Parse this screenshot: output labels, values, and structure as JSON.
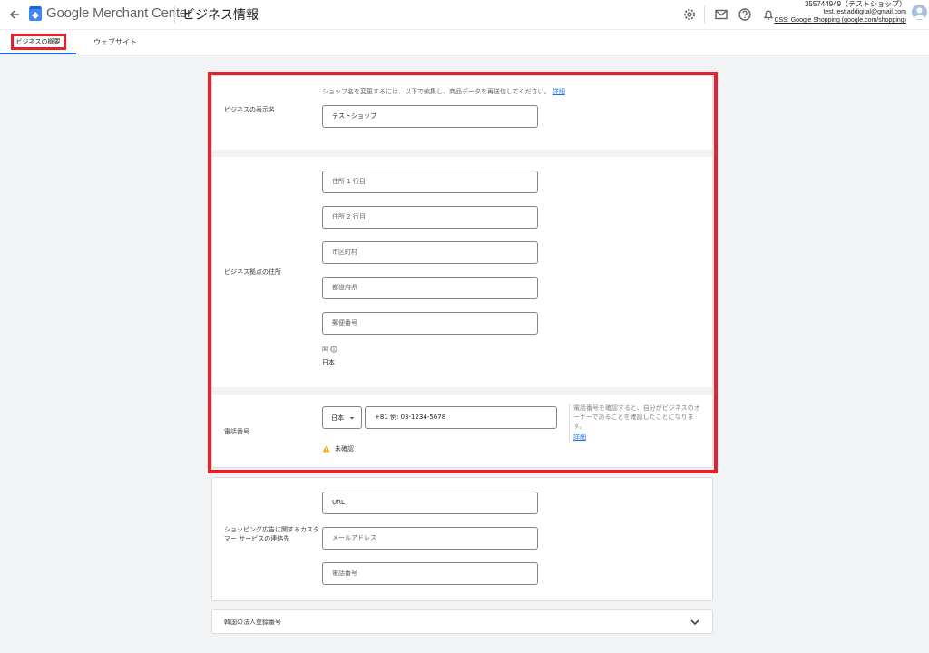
{
  "header": {
    "brand_google": "Google",
    "brand_product": "Merchant Center",
    "page_title": "ビジネス情報",
    "account_id": "355744949（テストショップ）",
    "account_email": "test.test.addigital@gmail.com",
    "account_css": "CSS: Google Shopping (google.com/shopping)"
  },
  "tabs": {
    "overview": "ビジネスの概要",
    "website": "ウェブサイト"
  },
  "business_name": {
    "label": "ビジネスの表示名",
    "hint": "ショップ名を変更するには、以下で編集し、商品データを再送信してください。",
    "hint_link": "詳細",
    "value": "テストショップ"
  },
  "address": {
    "label": "ビジネス拠点の住所",
    "line1": "住所 1 行目",
    "line2": "住所 2 行目",
    "city": "市区町村",
    "prefecture": "都道府県",
    "postal": "郵便番号",
    "country_label": "国",
    "country_value": "日本"
  },
  "phone": {
    "label": "電話番号",
    "country": "日本",
    "placeholder": "+81 例: 03-1234-5678",
    "status": "未確認",
    "note": "電話番号を確認すると、自分がビジネスのオーナーであることを確認したことになります。",
    "note_link": "詳細"
  },
  "customer_service": {
    "label": "ショッピング広告に関するカスタマー サービスの連絡先",
    "url": "URL",
    "email": "メールアドレス",
    "phone": "電話番号"
  },
  "korea": {
    "label": "韓国の法人登録番号"
  },
  "colors": {
    "accent": "#1a73e8",
    "highlight": "#e8202b",
    "warning": "#f9ab00"
  }
}
